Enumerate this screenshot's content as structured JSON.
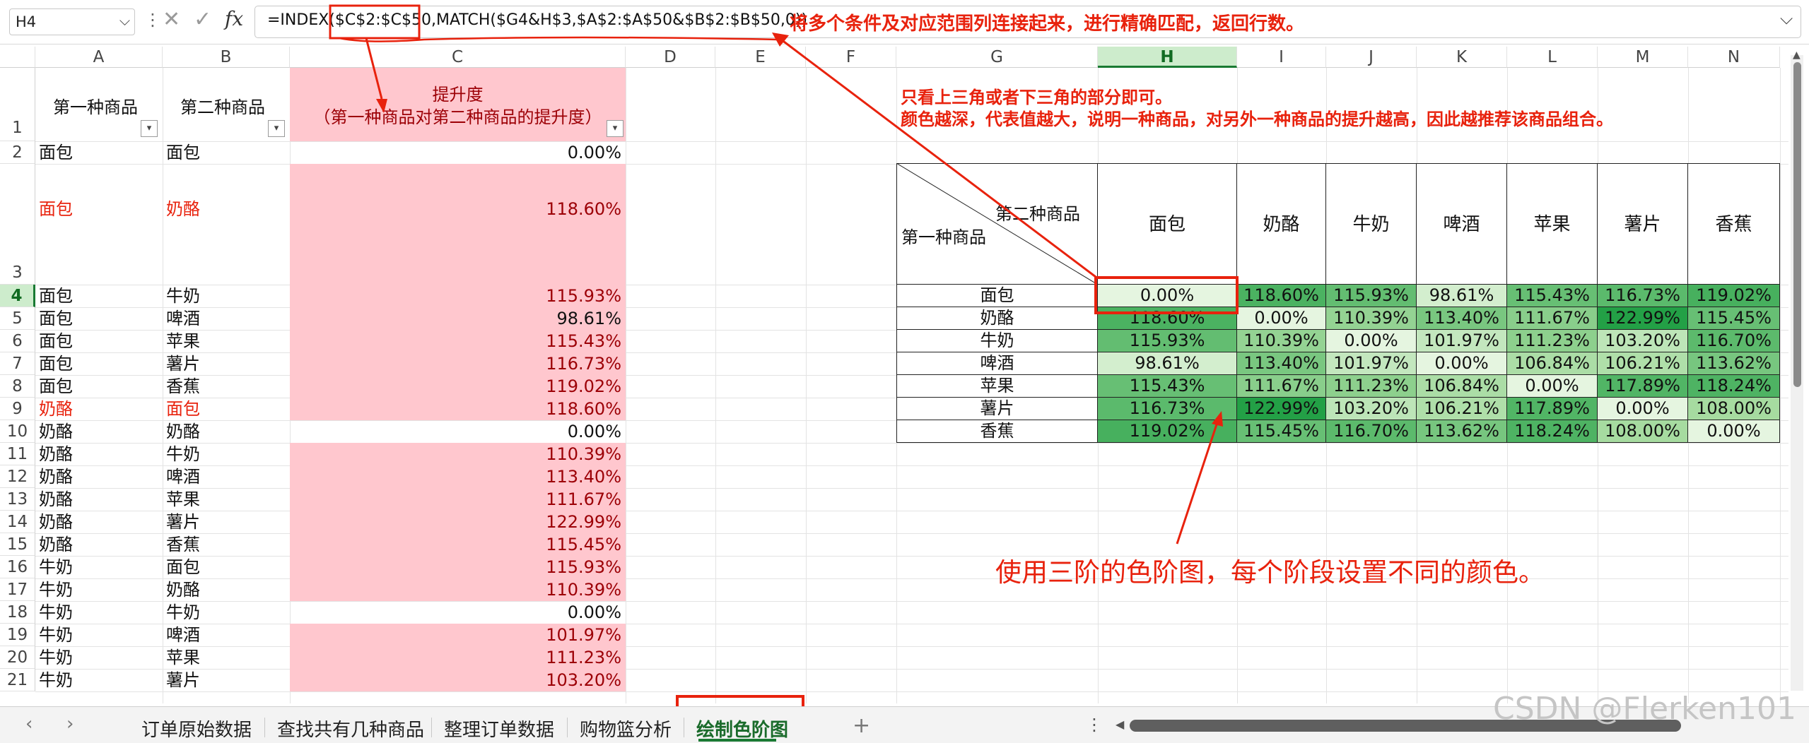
{
  "namebox": {
    "value": "H4"
  },
  "formula": {
    "text": "=INDEX($C$2:$C$50,MATCH($G4&H$3,$A$2:$A$50&$B$2:$B$50,0))",
    "note": "将多个条件及对应范围列连接起来，进行精确匹配，返回行数。"
  },
  "columns": [
    "A",
    "B",
    "C",
    "D",
    "E",
    "F",
    "G",
    "H",
    "I",
    "J",
    "K",
    "L",
    "M",
    "N"
  ],
  "header_row": {
    "a": "第一种商品",
    "b": "第二种商品",
    "c_title": "提升度",
    "c_sub": "（第一种商品对第二种商品的提升度）"
  },
  "rows": [
    {
      "n": "2",
      "a": "面包",
      "b": "面包",
      "c": "0.00%"
    },
    {
      "n": "3",
      "a": "面包",
      "b": "奶酪",
      "c": "118.60%"
    },
    {
      "n": "4",
      "a": "面包",
      "b": "牛奶",
      "c": "115.93%"
    },
    {
      "n": "5",
      "a": "面包",
      "b": "啤酒",
      "c": "98.61%"
    },
    {
      "n": "6",
      "a": "面包",
      "b": "苹果",
      "c": "115.43%"
    },
    {
      "n": "7",
      "a": "面包",
      "b": "薯片",
      "c": "116.73%"
    },
    {
      "n": "8",
      "a": "面包",
      "b": "香蕉",
      "c": "119.02%"
    },
    {
      "n": "9",
      "a": "奶酪",
      "b": "面包",
      "c": "118.60%"
    },
    {
      "n": "10",
      "a": "奶酪",
      "b": "奶酪",
      "c": "0.00%"
    },
    {
      "n": "11",
      "a": "奶酪",
      "b": "牛奶",
      "c": "110.39%"
    },
    {
      "n": "12",
      "a": "奶酪",
      "b": "啤酒",
      "c": "113.40%"
    },
    {
      "n": "13",
      "a": "奶酪",
      "b": "苹果",
      "c": "111.67%"
    },
    {
      "n": "14",
      "a": "奶酪",
      "b": "薯片",
      "c": "122.99%"
    },
    {
      "n": "15",
      "a": "奶酪",
      "b": "香蕉",
      "c": "115.45%"
    },
    {
      "n": "16",
      "a": "牛奶",
      "b": "面包",
      "c": "115.93%"
    },
    {
      "n": "17",
      "a": "牛奶",
      "b": "奶酪",
      "c": "110.39%"
    },
    {
      "n": "18",
      "a": "牛奶",
      "b": "牛奶",
      "c": "0.00%"
    },
    {
      "n": "19",
      "a": "牛奶",
      "b": "啤酒",
      "c": "101.97%"
    },
    {
      "n": "20",
      "a": "牛奶",
      "b": "苹果",
      "c": "111.23%"
    },
    {
      "n": "21",
      "a": "牛奶",
      "b": "薯片",
      "c": "103.20%"
    }
  ],
  "row1_label": "1",
  "matrix": {
    "corner_top": "第二种商品",
    "corner_bottom": "第一种商品",
    "products": [
      "面包",
      "奶酪",
      "牛奶",
      "啤酒",
      "苹果",
      "薯片",
      "香蕉"
    ],
    "values": [
      [
        "0.00%",
        "118.60%",
        "115.93%",
        "98.61%",
        "115.43%",
        "116.73%",
        "119.02%"
      ],
      [
        "118.60%",
        "0.00%",
        "110.39%",
        "113.40%",
        "111.67%",
        "122.99%",
        "115.45%"
      ],
      [
        "115.93%",
        "110.39%",
        "0.00%",
        "101.97%",
        "111.23%",
        "103.20%",
        "116.70%"
      ],
      [
        "98.61%",
        "113.40%",
        "101.97%",
        "0.00%",
        "106.84%",
        "106.21%",
        "113.62%"
      ],
      [
        "115.43%",
        "111.67%",
        "111.23%",
        "106.84%",
        "0.00%",
        "117.89%",
        "118.24%"
      ],
      [
        "116.73%",
        "122.99%",
        "103.20%",
        "106.21%",
        "117.89%",
        "0.00%",
        "108.00%"
      ],
      [
        "119.02%",
        "115.45%",
        "116.70%",
        "113.62%",
        "118.24%",
        "108.00%",
        "0.00%"
      ]
    ]
  },
  "annotations": {
    "line1": "只看上三角或者下三角的部分即可。",
    "line2": "颜色越深，代表值越大，说明一种商品，对另外一种商品的提升越高，因此越推荐该商品组合。",
    "big": "使用三阶的色阶图，每个阶段设置不同的颜色。"
  },
  "tabs": [
    "订单原始数据",
    "查找共有几种商品",
    "整理订单数据",
    "购物篮分析",
    "绘制色阶图"
  ],
  "active_tab": "绘制色阶图",
  "watermark": "CSDN @Flerken101",
  "colors": {
    "accent": "#1a7a33",
    "red": "#e8220d",
    "pink": "#ffc7ce",
    "scale_low": "#f7fcf5",
    "scale_mid": "#a1d99b",
    "scale_high": "#238b45"
  }
}
